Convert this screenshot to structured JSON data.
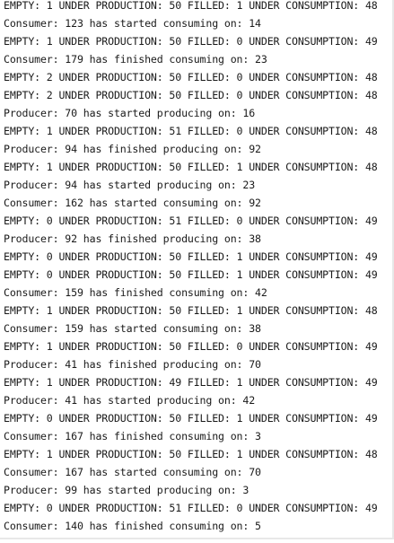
{
  "console": {
    "lines": [
      "EMPTY: 1 UNDER PRODUCTION: 50 FILLED: 1 UNDER CONSUMPTION: 48",
      "Consumer: 123 has started consuming on: 14",
      "EMPTY: 1 UNDER PRODUCTION: 50 FILLED: 0 UNDER CONSUMPTION: 49",
      "Consumer: 179 has finished consuming on: 23",
      "EMPTY: 2 UNDER PRODUCTION: 50 FILLED: 0 UNDER CONSUMPTION: 48",
      "EMPTY: 2 UNDER PRODUCTION: 50 FILLED: 0 UNDER CONSUMPTION: 48",
      "Producer: 70 has started producing on: 16",
      "EMPTY: 1 UNDER PRODUCTION: 51 FILLED: 0 UNDER CONSUMPTION: 48",
      "Producer: 94 has finished producing on: 92",
      "EMPTY: 1 UNDER PRODUCTION: 50 FILLED: 1 UNDER CONSUMPTION: 48",
      "Producer: 94 has started producing on: 23",
      "Consumer: 162 has started consuming on: 92",
      "EMPTY: 0 UNDER PRODUCTION: 51 FILLED: 0 UNDER CONSUMPTION: 49",
      "Producer: 92 has finished producing on: 38",
      "EMPTY: 0 UNDER PRODUCTION: 50 FILLED: 1 UNDER CONSUMPTION: 49",
      "EMPTY: 0 UNDER PRODUCTION: 50 FILLED: 1 UNDER CONSUMPTION: 49",
      "Consumer: 159 has finished consuming on: 42",
      "EMPTY: 1 UNDER PRODUCTION: 50 FILLED: 1 UNDER CONSUMPTION: 48",
      "Consumer: 159 has started consuming on: 38",
      "EMPTY: 1 UNDER PRODUCTION: 50 FILLED: 0 UNDER CONSUMPTION: 49",
      "Producer: 41 has finished producing on: 70",
      "EMPTY: 1 UNDER PRODUCTION: 49 FILLED: 1 UNDER CONSUMPTION: 49",
      "Producer: 41 has started producing on: 42",
      "EMPTY: 0 UNDER PRODUCTION: 50 FILLED: 1 UNDER CONSUMPTION: 49",
      "Consumer: 167 has finished consuming on: 3",
      "EMPTY: 1 UNDER PRODUCTION: 50 FILLED: 1 UNDER CONSUMPTION: 48",
      "Consumer: 167 has started consuming on: 70",
      "Producer: 99 has started producing on: 3",
      "EMPTY: 0 UNDER PRODUCTION: 51 FILLED: 0 UNDER CONSUMPTION: 49",
      "Consumer: 140 has finished consuming on: 5"
    ]
  }
}
